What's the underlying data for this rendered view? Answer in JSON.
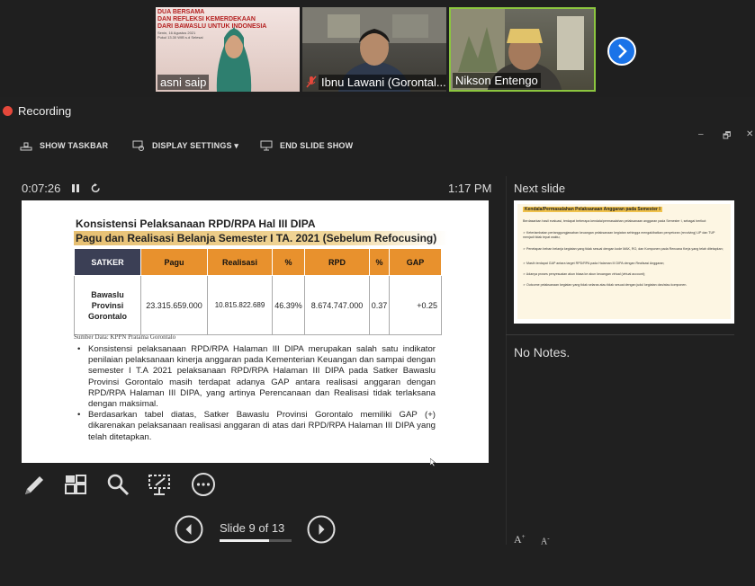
{
  "meeting": {
    "participants": [
      {
        "name": "asni saip",
        "muted": false
      },
      {
        "name": "Ibnu Lawani (Gorontal...",
        "muted": true
      },
      {
        "name": "Nikson Entengo",
        "muted": false,
        "active_speaker": true
      }
    ],
    "poster_lines": [
      "DUA BERSAMA",
      "DAN REFLEKSI KEMERDEKAAN",
      "DARI BAWASLU UNTUK INDONESIA"
    ],
    "poster_sub": [
      "Senin, 16 Agustus 2021",
      "Pukul 13.30 WIB s.d Selesai"
    ],
    "next_icon": "chevron-right-icon"
  },
  "recording": {
    "label": "Recording",
    "color": "#e5483b"
  },
  "toolbar": {
    "show_taskbar": "SHOW TASKBAR",
    "display_settings": "DISPLAY SETTINGS ▾",
    "end_slide_show": "END SLIDE SHOW",
    "minimize": "–",
    "restore": "🗗",
    "close": "✕"
  },
  "presenter": {
    "elapsed": "0:07:26",
    "pause_icon": "pause-icon",
    "reset_icon": "reset-icon",
    "clock": "1:17 PM",
    "next_slide_label": "Next slide",
    "notes": "No Notes.",
    "slide_counter": "Slide 9 of 13",
    "current_slide": 9,
    "total_slides": 13,
    "font_up": "A",
    "font_down": "A"
  },
  "slide": {
    "title": "Konsistensi Pelaksanaan RPD/RPA Hal III DIPA",
    "subtitle": "Pagu dan Realisasi Belanja Semester I TA. 2021 (Sebelum Refocusing)",
    "table": {
      "headers": [
        "SATKER",
        "Pagu",
        "Realisasi",
        "%",
        "RPD",
        "%",
        "GAP"
      ],
      "row": {
        "satker": [
          "Bawaslu",
          "Provinsi",
          "Gorontalo"
        ],
        "pagu": "23.315.659.000",
        "realisasi": "10.815.822.689",
        "pct1": "46.39%",
        "rpd": "8.674.747.000",
        "pct2": "0.37",
        "gap": "+0.25"
      }
    },
    "source": "Sumber Data: KPPN Pratama Gorontalo",
    "bullets": [
      "Konsistensi pelaksanaan RPD/RPA Halaman III DIPA merupakan salah satu indikator penilaian pelaksanaan kinerja anggaran pada Kementerian Keuangan dan sampai dengan semester I T.A 2021 pelaksanaan RPD/RPA Halaman III DIPA pada Satker Bawaslu Provinsi Gorontalo masih terdapat adanya GAP antara realisasi anggaran dengan RPD/RPA Halaman III DIPA, yang artinya Perencanaan dan Realisasi tidak terlaksana dengan maksimal.",
      "Berdasarkan tabel diatas, Satker Bawaslu Provinsi Gorontalo memiliki GAP (+) dikarenakan pelaksanaan realisasi anggaran di atas dari RPD/RPA Halaman III DIPA yang telah ditetapkan."
    ]
  },
  "next_slide": {
    "heading": "Kendala/Permasalahan Pelaksanaan Anggaran pada Semester I",
    "lines": [
      "Berdasarkan hasil evaluasi, terdapat beberapa kendala/permasalahan pelaksanaan anggaran pada Semester I, sebagai berikut:",
      "➢ Keterlambatan pertanggungjawaban keuangan pelaksanaan kegiatan sehingga mengakibatkan penyetoran (revolving) UP dan TUP menjadi tidak tepat waktu;",
      "➢ Penetapan beban belanja kegiatan yang tidak sesuai dengan kode MAK, RO, dan Komponen pada Rencana Kerja yang telah ditetapkan;",
      "➢ Masih terdapat GAP antara target RPD/RPA pada Halaman III DIPA dengan Realisasi Anggaran;",
      "➢ Adanya proses penyesuaian akun biasa ke akun keuangan virtual (virtual account);",
      "➢ Outcome pelaksanaan kegiatan yang tidak selaras atau tidak sesuai dengan judul kegiatan dan/atau komponen."
    ]
  },
  "tools": [
    "pen-icon",
    "slide-grid-icon",
    "magnifier-icon",
    "laser-pointer-icon",
    "more-options-icon"
  ]
}
